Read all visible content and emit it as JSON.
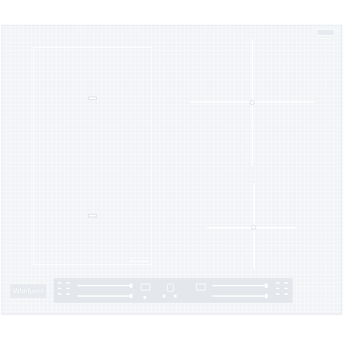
{
  "brand": {
    "logo_text": "Whirlpool"
  },
  "colors": {
    "surface": "#f1f3f6",
    "panel": "#e4e7eb",
    "marking": "#ffffff"
  },
  "icons": {
    "flexi_zone": "rectangle-outline",
    "cross_zone": "cross-hair",
    "timer": "timer-icon",
    "lock": "lock-icon",
    "power": "power-icon"
  }
}
